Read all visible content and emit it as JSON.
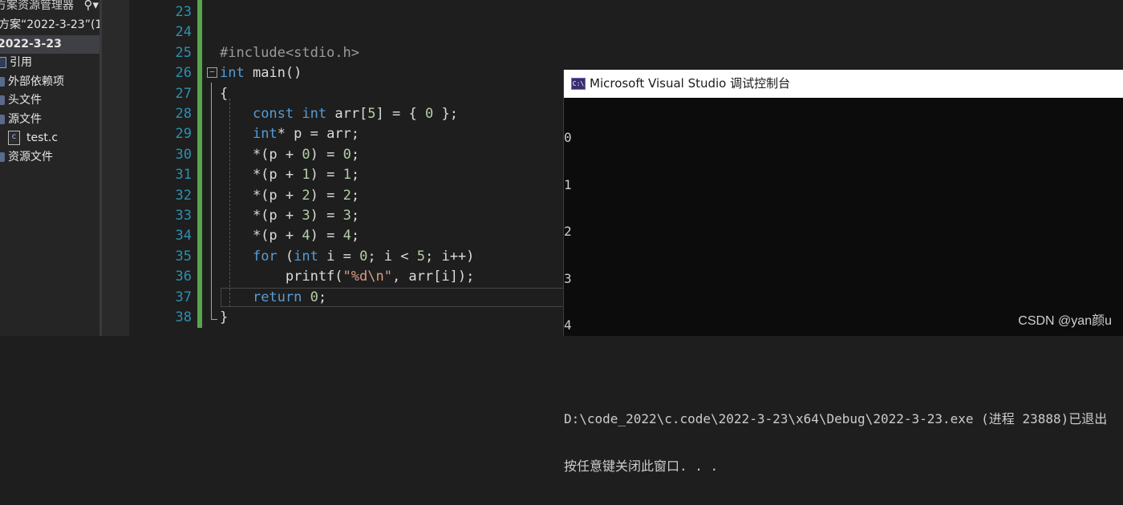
{
  "explorer": {
    "title": "方案资源管理器",
    "search_icon": "search-icon",
    "menu_icon": "chevron-down-icon",
    "solution_label": "方案“2022-3-23”(1",
    "project_label": "2022-3-23",
    "items": [
      {
        "label": "引用",
        "icon": "references-icon"
      },
      {
        "label": "外部依赖项",
        "icon": "external-deps-icon"
      },
      {
        "label": "头文件",
        "icon": "folder-icon"
      },
      {
        "label": "源文件",
        "icon": "folder-icon"
      },
      {
        "label": "test.c",
        "icon": "c-file-icon"
      },
      {
        "label": "资源文件",
        "icon": "folder-icon"
      }
    ]
  },
  "editor": {
    "line_numbers": [
      "23",
      "24",
      "25",
      "26",
      "27",
      "28",
      "29",
      "30",
      "31",
      "32",
      "33",
      "34",
      "35",
      "36",
      "37",
      "38"
    ],
    "collapse_glyph": "−"
  },
  "console": {
    "title": "Microsoft Visual Studio 调试控制台",
    "icon_text": "C:\\",
    "lines": [
      "0",
      "1",
      "2",
      "3",
      "4",
      "",
      "D:\\code_2022\\c.code\\2022-3-23\\x64\\Debug\\2022-3-23.exe (进程 23888)已退出",
      "按任意键关闭此窗口. . ."
    ]
  },
  "watermark": "CSDN @yan颜u",
  "colors": {
    "keyword": "#569cd6",
    "string": "#d69d85",
    "number": "#b5cea8",
    "line_number": "#2b91af",
    "change_bar": "#57a64a"
  }
}
